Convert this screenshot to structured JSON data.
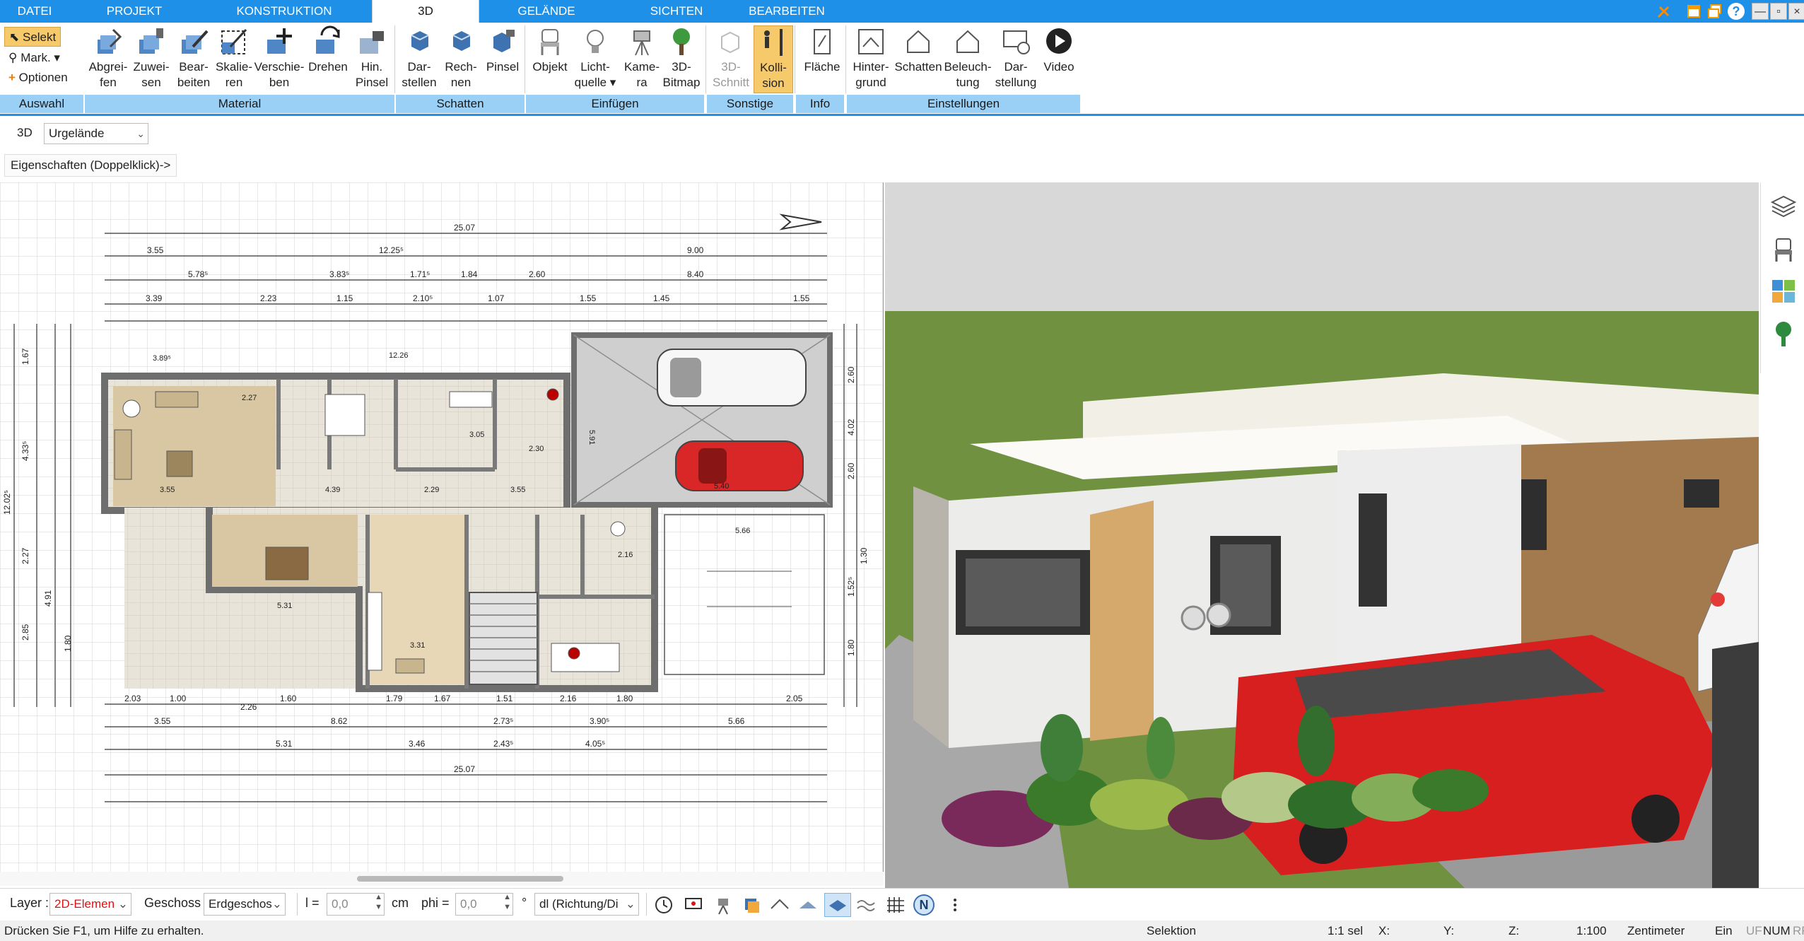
{
  "tabs": [
    {
      "label": "DATEI",
      "active": false
    },
    {
      "label": "PROJEKT",
      "active": false
    },
    {
      "label": "KONSTRUKTION",
      "active": false
    },
    {
      "label": "3D",
      "active": true
    },
    {
      "label": "GELÄNDE",
      "active": false
    },
    {
      "label": "SICHTEN",
      "active": false
    },
    {
      "label": "BEARBEITEN",
      "active": false
    }
  ],
  "window_controls": [
    "—",
    "▫",
    "×"
  ],
  "ribbon": {
    "auswahl": {
      "select": "Selekt",
      "mark": "Mark.",
      "options": "Optionen",
      "group": "Auswahl"
    },
    "material": {
      "group": "Material",
      "buttons": [
        {
          "l1": "Abgrei-",
          "l2": "fen",
          "icon": "eyedropper-icon"
        },
        {
          "l1": "Zuwei-",
          "l2": "sen",
          "icon": "paint-bucket-icon"
        },
        {
          "l1": "Bear-",
          "l2": "beiten",
          "icon": "edit-material-icon"
        },
        {
          "l1": "Skalie-",
          "l2": "ren",
          "icon": "scale-icon"
        },
        {
          "l1": "Verschie-",
          "l2": "ben",
          "icon": "move-icon"
        },
        {
          "l1": "Drehen",
          "l2": "",
          "icon": "rotate-icon"
        },
        {
          "l1": "Hin.",
          "l2": "Pinsel",
          "icon": "brush-icon"
        }
      ]
    },
    "schatten": {
      "group": "Schatten",
      "buttons": [
        {
          "l1": "Dar-",
          "l2": "stellen",
          "icon": "cube-shadow-icon"
        },
        {
          "l1": "Rech-",
          "l2": "nen",
          "icon": "cube-calc-icon"
        },
        {
          "l1": "Pinsel",
          "l2": "",
          "icon": "cube-brush-icon"
        }
      ]
    },
    "einfuegen": {
      "group": "Einfügen",
      "buttons": [
        {
          "l1": "Objekt",
          "l2": "",
          "icon": "chair-icon"
        },
        {
          "l1": "Licht-",
          "l2": "quelle ▾",
          "icon": "lightbulb-icon"
        },
        {
          "l1": "Kame-",
          "l2": "ra",
          "icon": "camera-icon"
        },
        {
          "l1": "3D-",
          "l2": "Bitmap",
          "icon": "tree-icon"
        }
      ]
    },
    "sonstige": {
      "group": "Sonstige",
      "buttons": [
        {
          "l1": "3D-",
          "l2": "Schnitt",
          "icon": "section-icon",
          "disabled": true
        },
        {
          "l1": "Kolli-",
          "l2": "sion",
          "icon": "collision-icon",
          "pressed": true
        }
      ]
    },
    "info": {
      "group": "Info",
      "buttons": [
        {
          "l1": "Fläche",
          "l2": "",
          "icon": "area-icon"
        }
      ]
    },
    "einstellungen": {
      "group": "Einstellungen",
      "buttons": [
        {
          "l1": "Hinter-",
          "l2": "grund",
          "icon": "background-house-icon"
        },
        {
          "l1": "Schatten",
          "l2": "",
          "icon": "shadow-house-icon"
        },
        {
          "l1": "Beleuch-",
          "l2": "tung",
          "icon": "lighting-house-icon"
        },
        {
          "l1": "Dar-",
          "l2": "stellung",
          "icon": "display-settings-icon"
        },
        {
          "l1": "Video",
          "l2": "",
          "icon": "play-icon"
        }
      ]
    }
  },
  "subbar": {
    "view_label": "3D",
    "terrain_select": "Urgelände",
    "properties_button": "Eigenschaften (Doppelklick)->"
  },
  "plan": {
    "dims_top": [
      "25.07",
      "3.55",
      "12.25⁵",
      "9.00",
      "5.78⁵",
      "8.40",
      "3.39",
      "2.23",
      "1.15",
      "2.10⁵",
      "1.07",
      "1.55",
      "1.45",
      "1.55",
      "3.83⁵",
      "1.71⁵",
      "1.84",
      "2.60"
    ],
    "dims_bottom": [
      "2.03",
      "1.00",
      "2.26",
      "1.60",
      "1.79",
      "1.67",
      "1.51",
      "2.16",
      "1.80",
      "2.05",
      "3.55",
      "8.62",
      "2.73⁵",
      "3.90⁵",
      "5.66",
      "5.31",
      "3.46",
      "2.43⁵",
      "4.05⁵",
      "25.07"
    ],
    "dims_left": [
      "1.67",
      "4.33⁵",
      "12.02⁵",
      "2.27",
      "4.91",
      "2.85",
      "1.80"
    ],
    "dims_right": [
      "2.60",
      "4.02",
      "2.60",
      "1.30",
      "1.52⁵",
      "1.80"
    ],
    "room_dims": [
      "12.26",
      "3.89⁵",
      "2.27",
      "3.55",
      "4.39",
      "2.29",
      "3.55",
      "5.31",
      "3.31",
      "2.30",
      "3.05",
      "2.16",
      "5.66",
      "5.91",
      "5.40"
    ]
  },
  "bottombar": {
    "layer_label": "Layer :",
    "layer_value": "2D-Elemen",
    "geschoss_label": "Geschoss :",
    "geschoss_value": "Erdgeschos",
    "l_label": "l =",
    "l_value": "0,0",
    "l_unit": "cm",
    "phi_label": "phi =",
    "phi_value": "0,0",
    "phi_unit": "°",
    "dl_value": "dl (Richtung/Di",
    "tools": [
      "clock-icon",
      "monitor-icon",
      "camera-small-icon",
      "layers-small-icon",
      "roof-icon",
      "texture-icon",
      "plane-icon",
      "waves-icon",
      "grid-icon",
      "north-icon",
      "more-icon"
    ]
  },
  "status": {
    "help": "Drücken Sie F1, um Hilfe zu erhalten.",
    "mode": "Selektion",
    "sel": "1:1 sel",
    "x": "X:",
    "y": "Y:",
    "z": "Z:",
    "scale": "1:100",
    "unit": "Zentimeter",
    "ein": "Ein",
    "uf": "UF",
    "num": "NUM",
    "rf": "RF"
  },
  "colors": {
    "accent": "#1e90e8",
    "group_label": "#9ad0f5",
    "pressed": "#f6c96a",
    "grass": "#6b8e3a",
    "car_red": "#d71f1f"
  }
}
